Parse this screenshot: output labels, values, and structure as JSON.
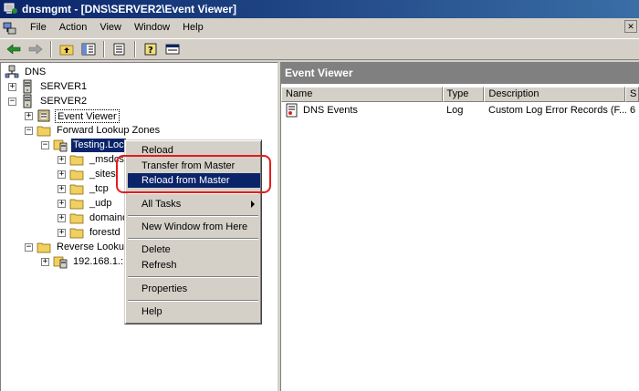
{
  "window": {
    "title": "dnsmgmt - [DNS\\SERVER2\\Event Viewer]"
  },
  "menu": {
    "items": [
      "File",
      "Action",
      "View",
      "Window",
      "Help"
    ]
  },
  "tree": {
    "root": "DNS",
    "server1": "SERVER1",
    "server2": "SERVER2",
    "event_viewer": "Event Viewer",
    "forward_zones": "Forward Lookup Zones",
    "testing_zone": "Testing.Loc",
    "subfolders": [
      "_msdcs",
      "_sites",
      "_tcp",
      "_udp",
      "domaind",
      "forestd"
    ],
    "reverse_zones": "Reverse Lookup",
    "reverse_item": "192.168.1.:"
  },
  "right_pane": {
    "header": "Event Viewer",
    "columns": [
      "Name",
      "Type",
      "Description",
      "S"
    ],
    "rows": [
      {
        "name": "DNS Events",
        "type": "Log",
        "description": "Custom Log Error Records (F...",
        "s": "6"
      }
    ]
  },
  "context_menu": {
    "items": [
      "Reload",
      "Transfer from Master",
      "Reload from Master",
      "All Tasks",
      "New Window from Here",
      "Delete",
      "Refresh",
      "Properties",
      "Help"
    ],
    "highlighted": "Reload from Master"
  },
  "colors": {
    "selection": "#0a246a",
    "highlight_ring": "#e51b1b",
    "pane_header": "#808080"
  },
  "icons": {
    "app": "dns-console-icon",
    "back": "back-arrow-icon",
    "forward": "forward-arrow-icon",
    "server": "server-icon",
    "folder": "folder-icon",
    "zone": "zone-icon",
    "event_log": "event-log-icon"
  }
}
